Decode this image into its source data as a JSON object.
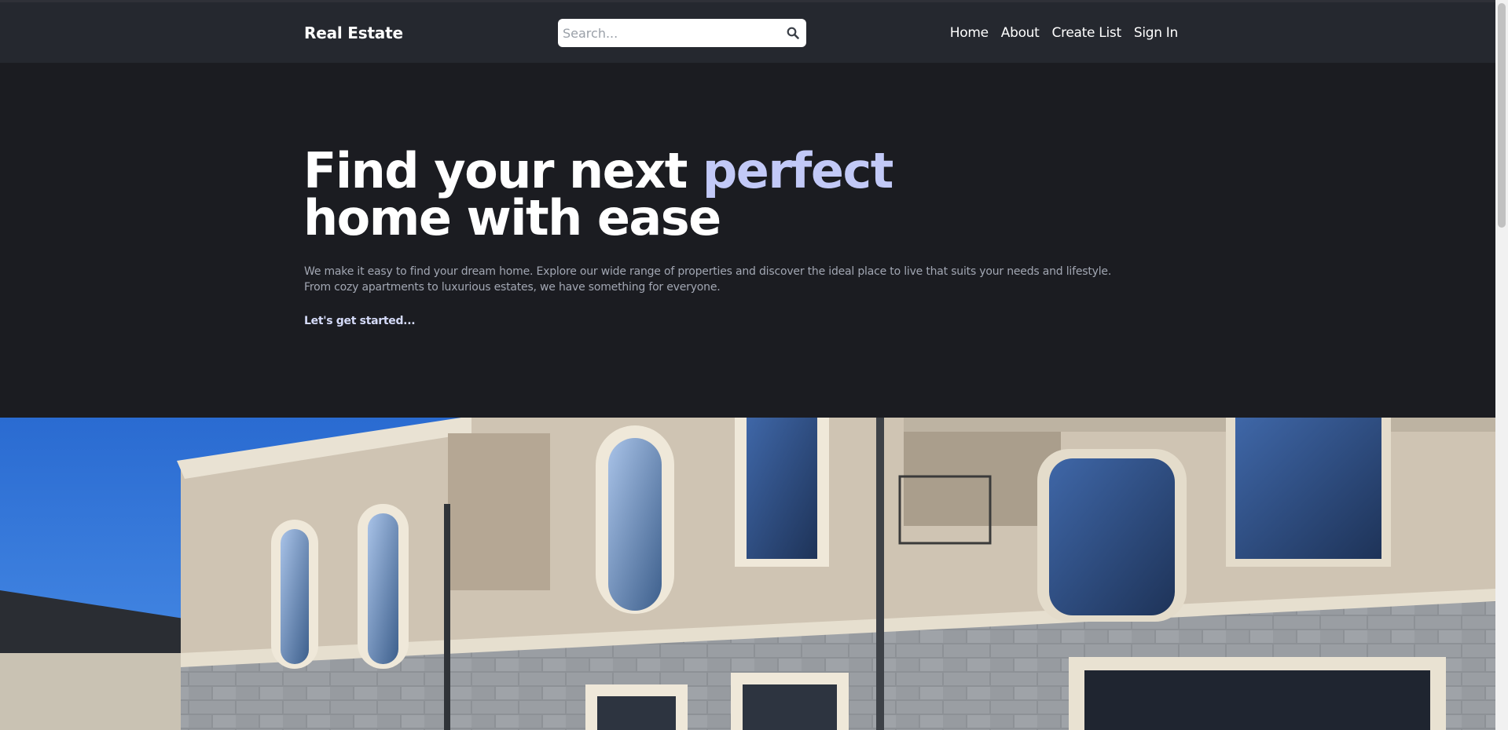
{
  "header": {
    "brand": "Real Estate",
    "search": {
      "placeholder": "Search...",
      "value": ""
    },
    "nav": [
      {
        "label": "Home"
      },
      {
        "label": "About"
      },
      {
        "label": "Create List"
      },
      {
        "label": "Sign In"
      }
    ]
  },
  "hero": {
    "headline_part1": "Find your next ",
    "headline_accent": "perfect",
    "headline_part2": "home with ease",
    "description_line1": "We make it easy to find your dream home. Explore our wide range of properties and discover the ideal place to live that suits your needs and lifestyle.",
    "description_line2": "From cozy apartments to luxurious estates, we have something for everyone.",
    "cta": "Let's get started..."
  },
  "icons": {
    "search": "search-icon"
  },
  "colors": {
    "background": "#1b1c21",
    "header": "#25282f",
    "accent": "#c2c9f7",
    "muted_text": "#a2a7b3"
  }
}
